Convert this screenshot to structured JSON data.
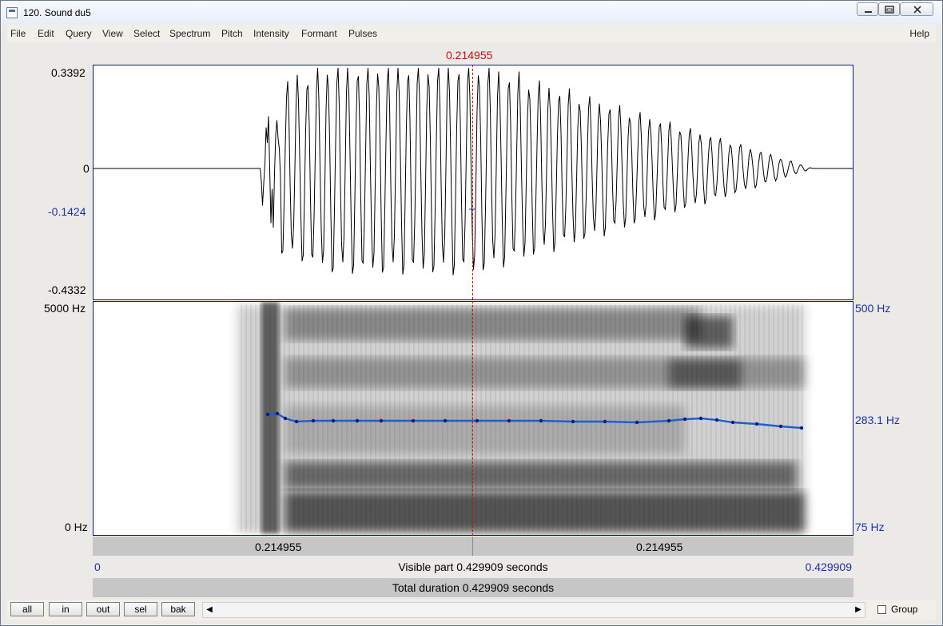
{
  "window": {
    "title": "120. Sound du5",
    "controls": [
      "minimize-icon",
      "maximize-icon",
      "close-icon"
    ]
  },
  "menu": {
    "items": [
      "File",
      "Edit",
      "Query",
      "View",
      "Select",
      "Spectrum",
      "Pitch",
      "Intensity",
      "Formant",
      "Pulses"
    ],
    "help": "Help"
  },
  "cursor": {
    "time": "0.214955",
    "color": "#cc1010"
  },
  "waveform": {
    "y_max": "0.3392",
    "y_zero": "0",
    "y_cursor": "-0.1424",
    "y_min": "-0.4332"
  },
  "spectrogram": {
    "freq_max": "5000 Hz",
    "freq_min": "0 Hz",
    "pitch_max": "500 Hz",
    "pitch_current": "283.1 Hz",
    "pitch_min": "75 Hz",
    "pitch_color": "#1f5fd0"
  },
  "timebar": {
    "left": "0.214955",
    "right": "0.214955"
  },
  "visible": {
    "start": "0",
    "label": "Visible part 0.429909 seconds",
    "end": "0.429909"
  },
  "total": {
    "label": "Total duration 0.429909 seconds"
  },
  "buttons": {
    "all": "all",
    "in": "in",
    "out": "out",
    "sel": "sel",
    "bak": "bak"
  },
  "group": {
    "label": "Group",
    "checked": false
  }
}
